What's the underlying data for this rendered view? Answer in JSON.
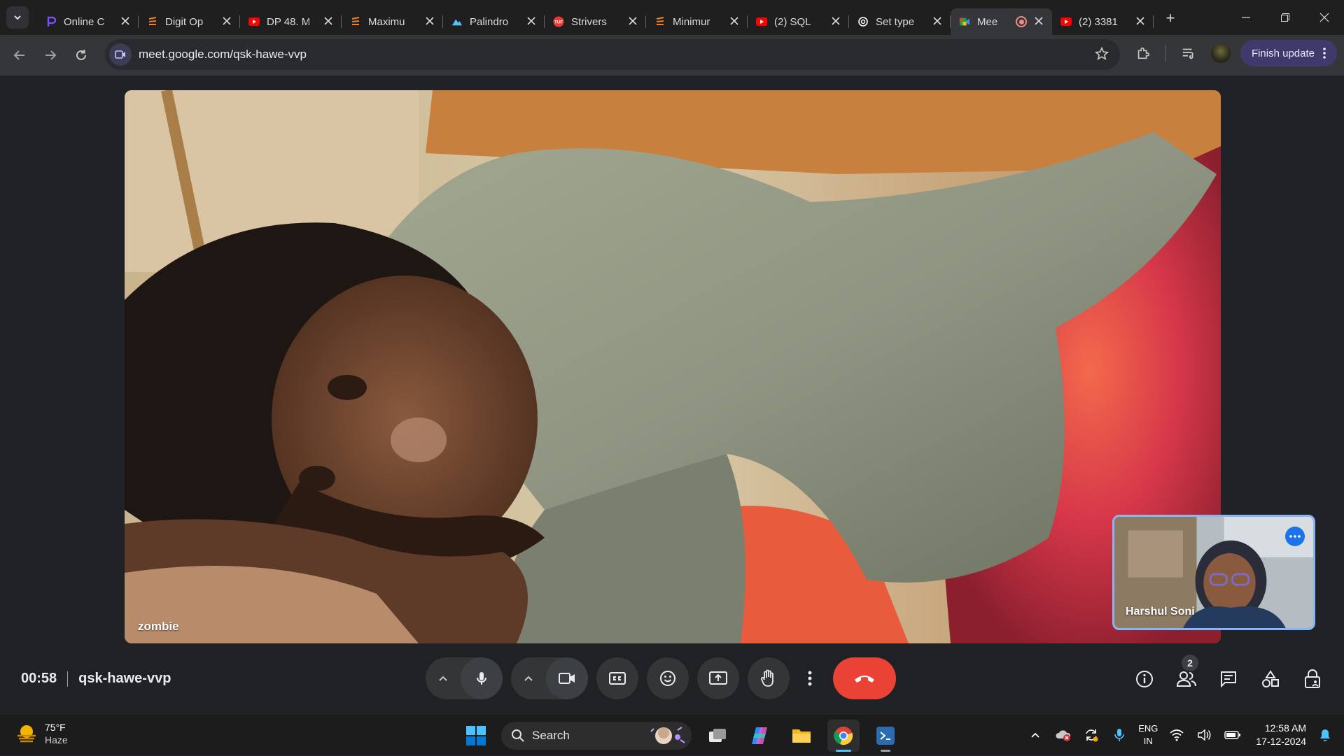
{
  "browser": {
    "tabs": [
      {
        "title": "Online C",
        "favicon": "p-logo-icon",
        "color": "#7c4dff"
      },
      {
        "title": "Digit Op",
        "favicon": "stackexchange-icon",
        "color": "#f48024"
      },
      {
        "title": "DP 48. M",
        "favicon": "youtube-icon",
        "color": "#ff0000"
      },
      {
        "title": "Maximu",
        "favicon": "stackexchange-icon",
        "color": "#f48024"
      },
      {
        "title": "Palindro",
        "favicon": "mountain-icon",
        "color": "#4fc3f7"
      },
      {
        "title": "Strivers",
        "favicon": "tuf-icon",
        "color": "#e53935"
      },
      {
        "title": "Minimur",
        "favicon": "stackexchange-icon",
        "color": "#f48024"
      },
      {
        "title": "(2) SQL",
        "favicon": "youtube-icon",
        "color": "#ff0000"
      },
      {
        "title": "Set type",
        "favicon": "openai-icon",
        "color": "#ffffff"
      },
      {
        "title": "Mee",
        "favicon": "google-meet-icon",
        "color": "#00ac47",
        "active": true,
        "recording": true
      },
      {
        "title": "(2) 3381",
        "favicon": "youtube-icon",
        "color": "#ff0000"
      }
    ],
    "url": "meet.google.com/qsk-hawe-vvp",
    "finish_update_label": "Finish update"
  },
  "meet": {
    "main_participant": "zombie",
    "self_participant": "Harshul Soni",
    "elapsed": "00:58",
    "meeting_code": "qsk-hawe-vvp",
    "participant_count": "2",
    "end_call_color": "#ea4335"
  },
  "taskbar": {
    "weather_temp": "75°F",
    "weather_condition": "Haze",
    "search_label": "Search",
    "language_line1": "ENG",
    "language_line2": "IN",
    "time": "12:58 AM",
    "date": "17-12-2024"
  }
}
